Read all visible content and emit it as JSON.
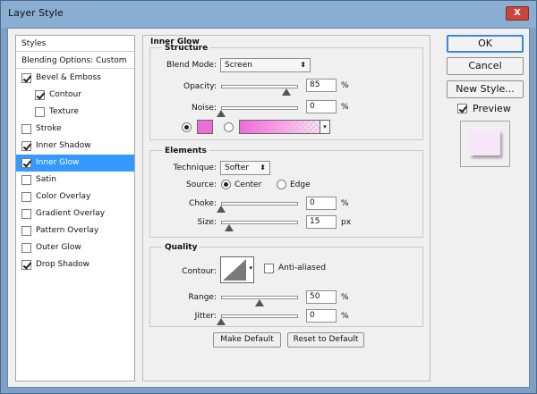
{
  "window": {
    "title": "Layer Style",
    "close_label": "X"
  },
  "style_list": {
    "header": "Styles",
    "blending_options": "Blending Options: Custom",
    "items": [
      {
        "label": "Bevel & Emboss",
        "checked": true,
        "indent": false,
        "selected": false
      },
      {
        "label": "Contour",
        "checked": true,
        "indent": true,
        "selected": false
      },
      {
        "label": "Texture",
        "checked": false,
        "indent": true,
        "selected": false
      },
      {
        "label": "Stroke",
        "checked": false,
        "indent": false,
        "selected": false
      },
      {
        "label": "Inner Shadow",
        "checked": true,
        "indent": false,
        "selected": false
      },
      {
        "label": "Inner Glow",
        "checked": true,
        "indent": false,
        "selected": true
      },
      {
        "label": "Satin",
        "checked": false,
        "indent": false,
        "selected": false
      },
      {
        "label": "Color Overlay",
        "checked": false,
        "indent": false,
        "selected": false
      },
      {
        "label": "Gradient Overlay",
        "checked": false,
        "indent": false,
        "selected": false
      },
      {
        "label": "Pattern Overlay",
        "checked": false,
        "indent": false,
        "selected": false
      },
      {
        "label": "Outer Glow",
        "checked": false,
        "indent": false,
        "selected": false
      },
      {
        "label": "Drop Shadow",
        "checked": true,
        "indent": false,
        "selected": false
      }
    ]
  },
  "panel": {
    "title": "Inner Glow",
    "structure": {
      "title": "Structure",
      "blend_mode_label": "Blend Mode:",
      "blend_mode_value": "Screen",
      "opacity_label": "Opacity:",
      "opacity_value": "85",
      "opacity_unit": "%",
      "opacity_level": 0.85,
      "noise_label": "Noise:",
      "noise_value": "0",
      "noise_unit": "%",
      "noise_level": 0.0,
      "glow_color": "#f06cd8"
    },
    "elements": {
      "title": "Elements",
      "technique_label": "Technique:",
      "technique_value": "Softer",
      "source_label": "Source:",
      "source_center": "Center",
      "source_edge": "Edge",
      "choke_label": "Choke:",
      "choke_value": "0",
      "choke_unit": "%",
      "choke_level": 0.0,
      "size_label": "Size:",
      "size_value": "15",
      "size_unit": "px",
      "size_level": 0.1
    },
    "quality": {
      "title": "Quality",
      "contour_label": "Contour:",
      "anti_aliased_label": "Anti-aliased",
      "range_label": "Range:",
      "range_value": "50",
      "range_unit": "%",
      "range_level": 0.5,
      "jitter_label": "Jitter:",
      "jitter_value": "0",
      "jitter_unit": "%",
      "jitter_level": 0.0
    },
    "make_default": "Make Default",
    "reset_default": "Reset to Default"
  },
  "buttons": {
    "ok": "OK",
    "cancel": "Cancel",
    "new_style": "New Style...",
    "preview_label": "Preview",
    "preview_checked": true,
    "preview_swatch_color": "#f7e6f7"
  }
}
